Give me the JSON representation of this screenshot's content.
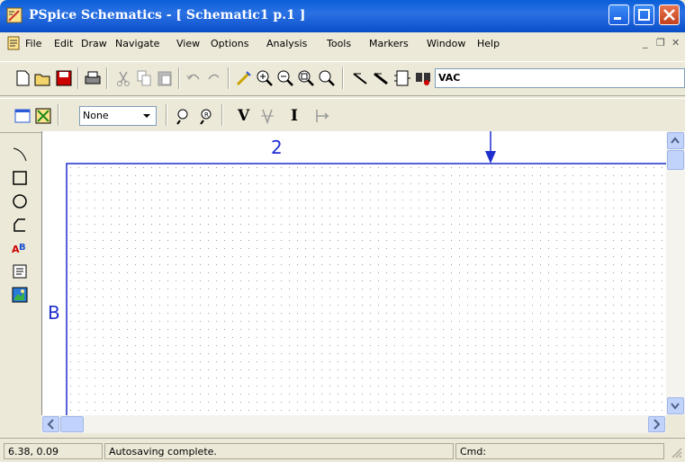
{
  "window": {
    "title": "PSpice Schematics - [ Schematic1  p.1  ]"
  },
  "menubar": {
    "items": [
      "File",
      "Edit",
      "Draw",
      "Navigate",
      "View",
      "Options",
      "Analysis",
      "Tools",
      "Markers",
      "Window",
      "Help"
    ]
  },
  "toolbar": {
    "part_field": "VAC",
    "filter_select": "None",
    "voltage_marker": "V",
    "current_marker": "I"
  },
  "canvas": {
    "column_label": "2",
    "row_label": "B"
  },
  "statusbar": {
    "coordinates": "6.38, 0.09",
    "message": "Autosaving complete.",
    "cmd_label": "Cmd:"
  },
  "colors": {
    "title_bar": "#0a5fd8",
    "border_blue": "#1f2fcf"
  }
}
